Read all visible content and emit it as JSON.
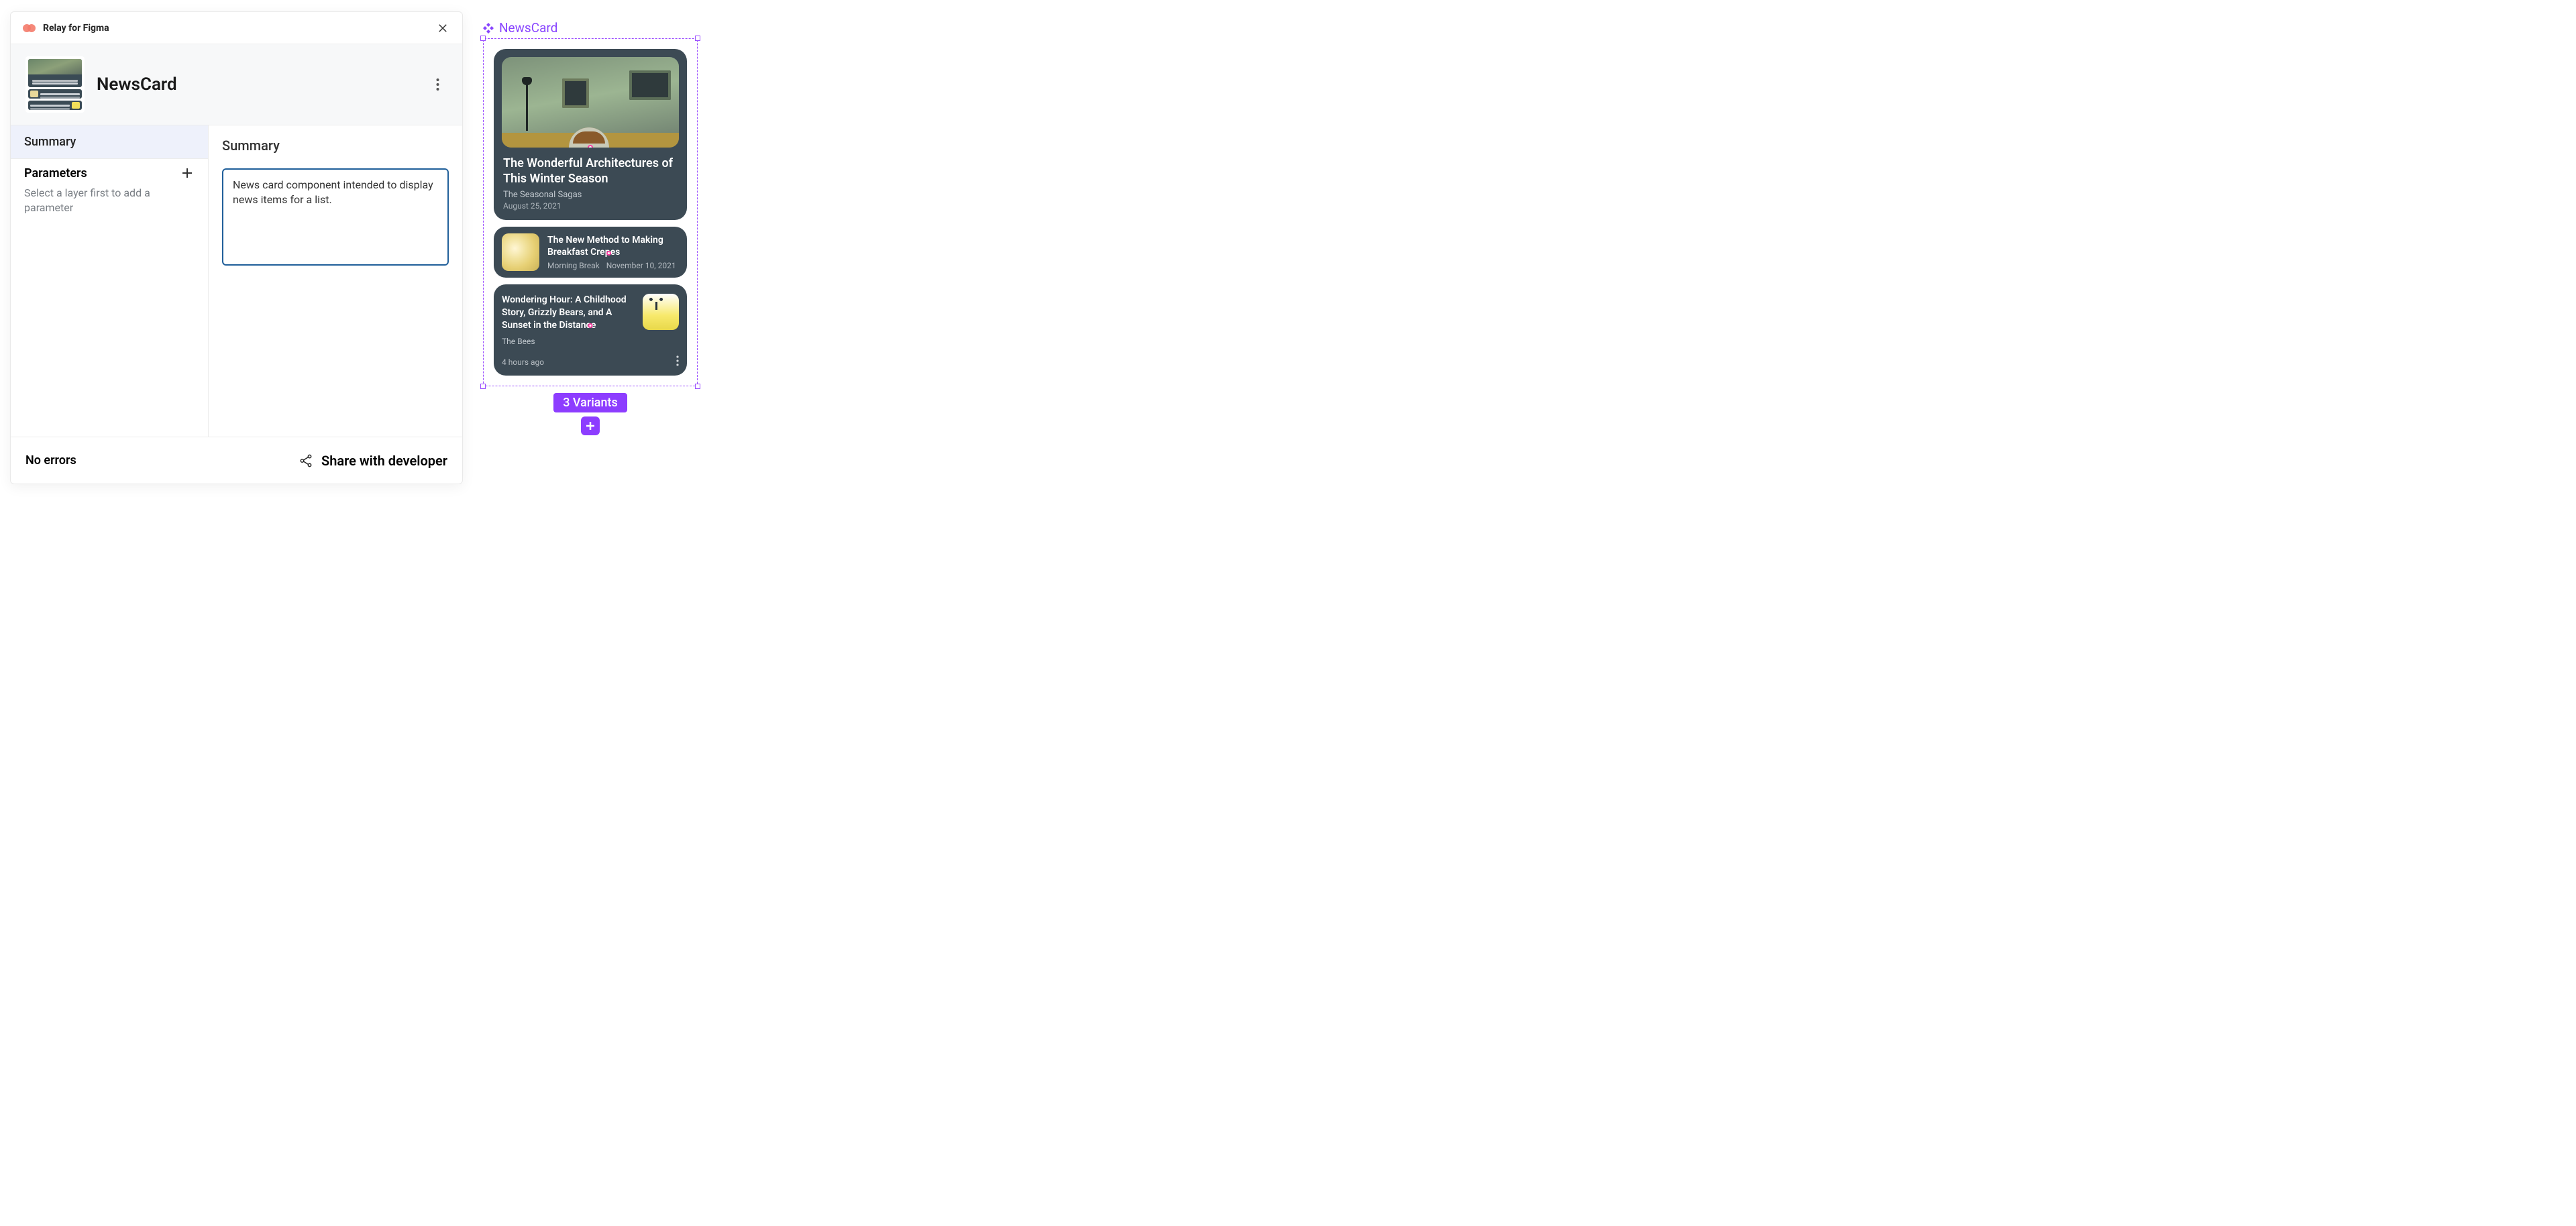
{
  "plugin": {
    "title": "Relay for Figma"
  },
  "component": {
    "name": "NewsCard",
    "canvas_label": "NewsCard"
  },
  "sidebar": {
    "tab_summary": "Summary",
    "parameters_heading": "Parameters",
    "parameters_hint": "Select a layer first to add a parameter"
  },
  "main": {
    "heading": "Summary",
    "description": "News card component intended to display news items for a list."
  },
  "footer": {
    "status": "No errors",
    "share_label": "Share with developer"
  },
  "variants": {
    "label": "3 Variants"
  },
  "preview": {
    "card1": {
      "title": "The Wonderful Architectures of This Winter Season",
      "subtitle": "The Seasonal Sagas",
      "date": "August 25, 2021"
    },
    "card2": {
      "title": "The New Method to Making Breakfast Crepes",
      "source": "Morning Break",
      "date": "November 10, 2021"
    },
    "card3": {
      "title": "Wondering Hour: A Childhood Story, Grizzly Bears, and A Sunset in the Distance",
      "source": "The Bees",
      "time": "4 hours ago"
    }
  }
}
